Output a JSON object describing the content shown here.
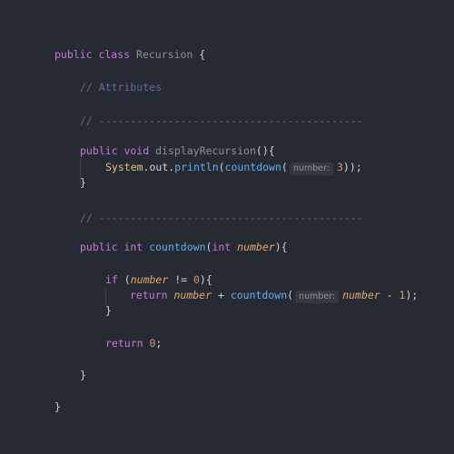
{
  "code": {
    "l1": {
      "kw": "public class",
      "name": "Recursion",
      "brace": "{"
    },
    "l2": {
      "comment": "// Attributes"
    },
    "l3": {
      "comment": "// ------------------------------------------"
    },
    "l4": {
      "kw": "public void",
      "name": "displayRecursion",
      "rest": "(){"
    },
    "l5": {
      "obj": "System",
      "out": ".out.",
      "fn": "println",
      "open": "(",
      "call": "countdown",
      "paren": "(",
      "hint": "number:",
      "arg": "3",
      "close": "));"
    },
    "l6": {
      "brace": "}"
    },
    "l7": {
      "comment": "// ------------------------------------------"
    },
    "l8": {
      "kw": "public int",
      "name": "countdown",
      "open": "(",
      "type": "int",
      "param": "number",
      "close": "){"
    },
    "l9": {
      "kw": "if",
      "open": " (",
      "param": "number",
      "op": " != ",
      "num": "0",
      "close": "){"
    },
    "l10": {
      "kw": "return",
      "param": "number",
      "op": " + ",
      "call": "countdown",
      "open": "(",
      "hint": "number:",
      "arg": "number",
      "minus": " - ",
      "num": "1",
      "close": ");"
    },
    "l11": {
      "brace": "}"
    },
    "l12": {
      "kw": "return",
      "num": "0",
      "semi": ";"
    },
    "l13": {
      "brace": "}"
    },
    "l14": {
      "brace": "}"
    }
  }
}
